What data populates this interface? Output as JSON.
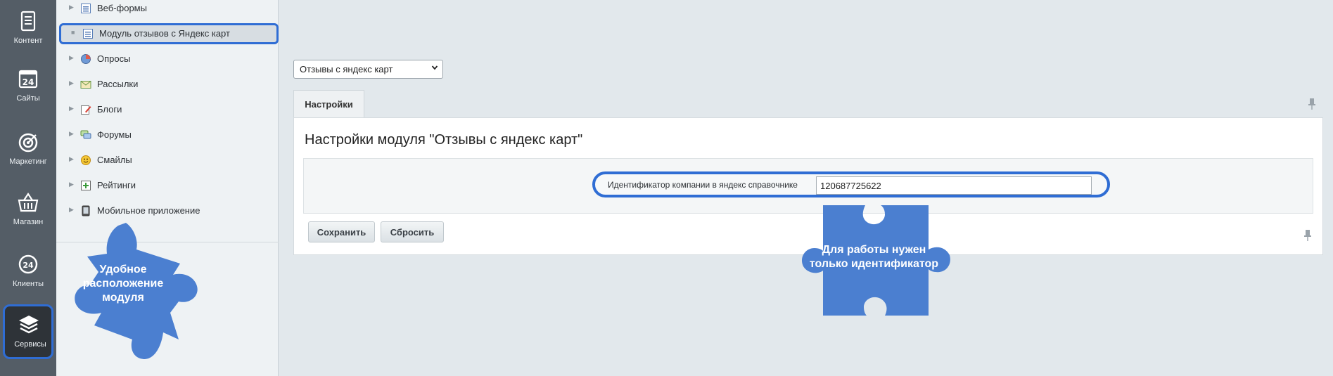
{
  "rail": {
    "items": [
      {
        "label": "Контент",
        "icon": "document-icon"
      },
      {
        "label": "Сайты",
        "icon": "calendar-24-icon"
      },
      {
        "label": "Маркетинг",
        "icon": "target-icon"
      },
      {
        "label": "Магазин",
        "icon": "basket-icon"
      },
      {
        "label": "Клиенты",
        "icon": "clients-24-icon"
      },
      {
        "label": "Сервисы",
        "icon": "layers-icon"
      }
    ]
  },
  "tree": {
    "items": [
      {
        "label": "Веб-формы",
        "icon": "form-icon"
      },
      {
        "label": "Модуль отзывов с Яндекс карт",
        "icon": "form-icon"
      },
      {
        "label": "Опросы",
        "icon": "pie-chart-icon"
      },
      {
        "label": "Рассылки",
        "icon": "envelope-icon"
      },
      {
        "label": "Блоги",
        "icon": "blog-pencil-icon"
      },
      {
        "label": "Форумы",
        "icon": "chat-icon"
      },
      {
        "label": "Смайлы",
        "icon": "smiley-icon"
      },
      {
        "label": "Рейтинги",
        "icon": "rating-plus-icon"
      },
      {
        "label": "Мобильное приложение",
        "icon": "mobile-icon"
      }
    ]
  },
  "main": {
    "module_select": "Отзывы с яндекс карт",
    "tab_label": "Настройки",
    "panel_title": "Настройки модуля \"Отзывы с яндекс карт\"",
    "field_label": "Идентификатор компании в яндекс справочнике",
    "field_value": "120687725622",
    "save_button": "Сохранить",
    "reset_button": "Сбросить"
  },
  "callouts": {
    "left": "Удобное расположение модуля",
    "right": "Для работы нужен только идентификатор"
  },
  "colors": {
    "accent": "#2f6dd4",
    "puzzle": "#4b7fd0",
    "rail": "#545d66"
  }
}
